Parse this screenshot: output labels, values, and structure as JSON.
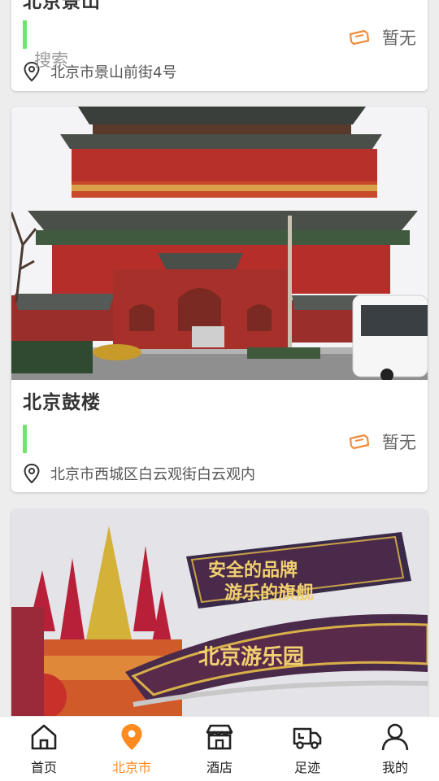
{
  "search": {
    "placeholder_text": "搜索"
  },
  "cards": [
    {
      "title": "北京景山",
      "price": "暂无",
      "address": "北京市景山前街4号"
    },
    {
      "title": "北京鼓楼",
      "price": "暂无",
      "address": "北京市西城区白云观街白云观内"
    },
    {
      "title": "",
      "price": "",
      "address": "",
      "sign_line1": "安全的品牌",
      "sign_line2": "游乐的旗舰",
      "sign_main": "北京游乐园"
    }
  ],
  "nav": [
    {
      "label": "首页",
      "icon": "home-icon",
      "active": false
    },
    {
      "label": "北京市",
      "icon": "location-pin-icon",
      "active": true
    },
    {
      "label": "酒店",
      "icon": "store-icon",
      "active": false
    },
    {
      "label": "足迹",
      "icon": "truck-icon",
      "active": false
    },
    {
      "label": "我的",
      "icon": "user-icon",
      "active": false
    }
  ],
  "colors": {
    "accent": "#ff8a1f",
    "green_marker": "#6ee46c",
    "ticket_icon": "#f08c3c"
  }
}
